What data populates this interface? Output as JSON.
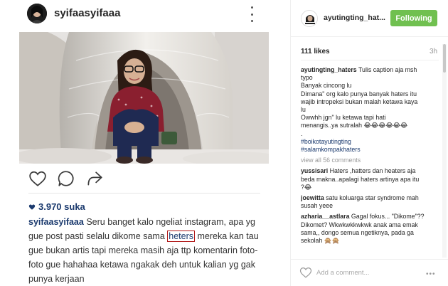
{
  "left_post": {
    "username": "syifaasyifaaa",
    "likes": "3.970 suka",
    "caption_user": "syifaasyifaaa",
    "caption_before": "Seru banget kalo ngeliat instagram, apa yg gue post pasti selalu dikome sama",
    "caption_highlight": "heters",
    "caption_after": "mereka kan tau gue bukan artis tapi mereka masih aja ttp komentarin foto-foto gue hahahaa ketawa ngakak deh untuk kalian yg gak punya kerjaan"
  },
  "right_post": {
    "username": "ayutingting_hat...",
    "follow_label": "Following",
    "likes": "111 likes",
    "time": "3h",
    "caption_user": "ayutingting_haters",
    "caption_lines": [
      "Tulis caption aja msh",
      "typo",
      "Banyak cincong lu",
      "Dimana\" org kalo punya banyak haters itu",
      "wajib intropeksi bukan malah ketawa kaya",
      "lu",
      "Owwhh jgn\" lu ketawa tapi hati",
      "menangis..ya sutralah 😂😂😂😂😂😂",
      "."
    ],
    "hashtags": [
      "#boikotayutingting",
      "#salamkompakhaters"
    ],
    "view_all": "view all 56 comments",
    "comments": [
      {
        "user": "yussisari",
        "lines": [
          "Haters ,hatters dan heaters aja",
          "beda makna..apalagi haters artinya apa itu",
          "?😂"
        ]
      },
      {
        "user": "joewitta",
        "lines": [
          "satu koluarga star syndrome mah",
          "susah yeee"
        ]
      },
      {
        "user": "azharia__astlara",
        "lines": [
          "Gagal fokus... \"Dikome\"??",
          "Dikomet? Wkwkwkkwkwk anak ama emak",
          "sama,, dongo semua ngetiknya, pada ga",
          "sekolah 🙊🙊"
        ]
      }
    ],
    "add_comment_placeholder": "Add a comment...",
    "options_label": "•••"
  },
  "colors": {
    "follow_button": "#70c050",
    "link_blue": "#1b3a6e",
    "highlight_border": "#b01818"
  }
}
